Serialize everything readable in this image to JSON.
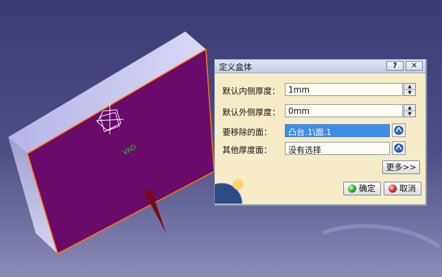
{
  "dialog": {
    "title": "定义盒体",
    "help_label": "?",
    "close_label": "✕",
    "default_inner": {
      "label": "默认内侧厚度：",
      "value": "1mm"
    },
    "default_outer": {
      "label": "默认外侧厚度：",
      "value": "0mm"
    },
    "faces_to_remove": {
      "label": "要移除的面：",
      "value": "凸台.1\\面.1"
    },
    "other_thickness": {
      "label": "其他厚度面：",
      "value": "没有选择"
    },
    "more_label": "更多>>",
    "ok_label": "确定",
    "cancel_label": "取消"
  },
  "viewport": {
    "part_label": "VAD",
    "colors": {
      "background_top": "#3c3a74",
      "background_bottom": "#8a8cb6",
      "face_selected": "#6a0a6a",
      "face_edge": "#ff7a00",
      "box_side": "#c9c8ee",
      "arrow": "#7a0a14"
    }
  }
}
